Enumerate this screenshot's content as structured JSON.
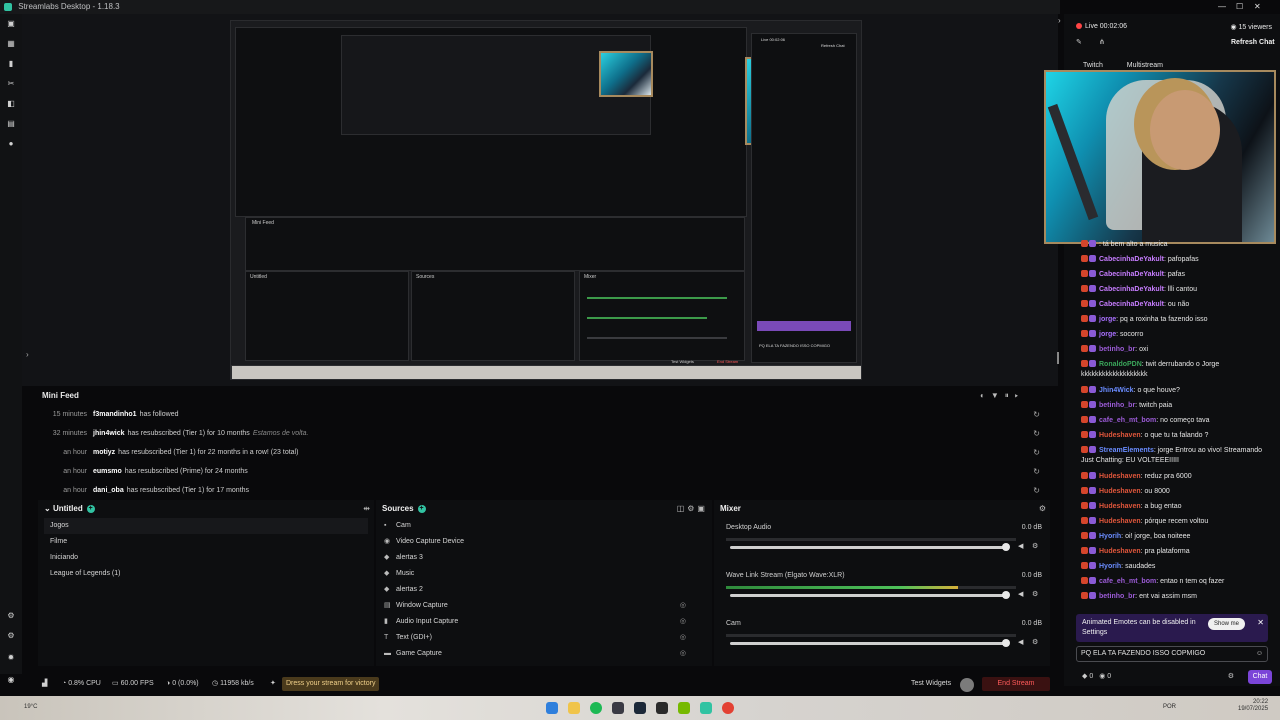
{
  "window": {
    "title": "Streamlabs Desktop - 1.18.3"
  },
  "nested_preview": {
    "live_label": "Live 00:02:06",
    "refresh_label": "Refresh Chat",
    "minifeed_label": "Mini Feed",
    "scenes_label": "Untitled",
    "sources_label": "Sources",
    "mixer_label": "Mixer",
    "end_label": "End Stream",
    "test_label": "Test Widgets",
    "chat_msg": "PQ ELA TA FAZENDO ISSO COPMIGO"
  },
  "minifeed": {
    "title": "Mini Feed",
    "items": [
      {
        "time": "15 minutes",
        "user": "f3mandinho1",
        "text": "has followed",
        "note": ""
      },
      {
        "time": "32 minutes",
        "user": "jhin4wick",
        "text": "has resubscribed (Tier 1) for 10 months",
        "note": "Estamos de volta."
      },
      {
        "time": "an hour",
        "user": "motiyz",
        "text": "has resubscribed (Tier 1) for 22 months in a row! (23 total)",
        "note": ""
      },
      {
        "time": "an hour",
        "user": "eumsmo",
        "text": "has resubscribed (Prime) for 24 months",
        "note": ""
      },
      {
        "time": "an hour",
        "user": "dani_oba",
        "text": "has resubscribed (Tier 1) for 17 months",
        "note": ""
      }
    ]
  },
  "scenes": {
    "title": "Untitled",
    "items": [
      "Jogos",
      "Filme",
      "Iniciando",
      "League of Legends (1)"
    ]
  },
  "sources": {
    "title": "Sources",
    "items": [
      "Cam",
      "Video Capture Device",
      "alertas 3",
      "Music",
      "alertas 2",
      "Window Capture",
      "Audio Input Capture",
      "Text (GDI+)",
      "Game Capture"
    ]
  },
  "mixer": {
    "title": "Mixer",
    "channels": [
      {
        "name": "Desktop Audio",
        "db": "0.0 dB",
        "level": 0.0
      },
      {
        "name": "Wave Link Stream (Elgato Wave:XLR)",
        "db": "0.0 dB",
        "level": 0.8
      },
      {
        "name": "Cam",
        "db": "0.0 dB",
        "level": 0.0
      }
    ]
  },
  "statusbar": {
    "cpu": "0.8% CPU",
    "fps": "60.00 FPS",
    "dropped": "0 (0.0%)",
    "bitrate": "11958 kb/s",
    "dress_label": "Dress your stream for victory",
    "test_widgets": "Test Widgets",
    "end_stream": "End Stream"
  },
  "chat": {
    "live": "Live 00:02:06",
    "viewers": "15 viewers",
    "refresh": "Refresh Chat",
    "tabs": [
      "Twitch",
      "Multistream"
    ],
    "messages": [
      {
        "user": "",
        "text": "tá bem alto a musica",
        "color": "#e0563b"
      },
      {
        "user": "CabecinhaDeYakult",
        "text": "pafopafas",
        "color": "#c77dff"
      },
      {
        "user": "CabecinhaDeYakult",
        "text": "pafas",
        "color": "#c77dff"
      },
      {
        "user": "CabecinhaDeYakult",
        "text": "llli cantou",
        "color": "#c77dff"
      },
      {
        "user": "CabecinhaDeYakult",
        "text": "ou não",
        "color": "#c77dff"
      },
      {
        "user": "jorge",
        "text": "pq a roxinha ta fazendo isso",
        "color": "#a970ff"
      },
      {
        "user": "jorge",
        "text": "socorro",
        "color": "#a970ff"
      },
      {
        "user": "betinho_br",
        "text": "oxi",
        "color": "#9b5bd6"
      },
      {
        "user": "RonaldoPDN",
        "text": "twit derrubando o Jorge kkkkkkkkkkkkkkkkkkk",
        "color": "#3aa55a"
      },
      {
        "user": "Jhin4Wick",
        "text": "o que houve?",
        "color": "#6a8cff"
      },
      {
        "user": "betinho_br",
        "text": "twitch paia",
        "color": "#9b5bd6"
      },
      {
        "user": "cafe_eh_mt_bom",
        "text": "no começo tava",
        "color": "#9b5bd6"
      },
      {
        "user": "Hudeshaven",
        "text": "o que tu ta falando ?",
        "color": "#e0563b"
      },
      {
        "user": "StreamElements",
        "text": "jorge Entrou ao vivo! Streamando Just Chatting: EU VOLTEEEIIIII",
        "color": "#6a8cff"
      },
      {
        "user": "Hudeshaven",
        "text": "reduz pra 6000",
        "color": "#e0563b"
      },
      {
        "user": "Hudeshaven",
        "text": "ou 8000",
        "color": "#e0563b"
      },
      {
        "user": "Hudeshaven",
        "text": "a bug entao",
        "color": "#e0563b"
      },
      {
        "user": "Hudeshaven",
        "text": "pórque recem voltou",
        "color": "#e0563b"
      },
      {
        "user": "Hyorih",
        "text": "oi! jorge, boa noiteee",
        "color": "#6a8cff"
      },
      {
        "user": "Hudeshaven",
        "text": "pra plataforma",
        "color": "#e0563b"
      },
      {
        "user": "Hyorih",
        "text": "saudades",
        "color": "#6a8cff"
      },
      {
        "user": "cafe_eh_mt_bom",
        "text": "entao n tem oq fazer",
        "color": "#9b5bd6"
      },
      {
        "user": "betinho_br",
        "text": "ent vai assim msm",
        "color": "#9b5bd6"
      }
    ],
    "emote_banner": "Animated Emotes can be disabled in Settings",
    "show_me": "Show me",
    "input_value": "PQ ELA TA FAZENDO ISSO COPMIGO",
    "points": "0",
    "points2": "0",
    "chat_button": "Chat"
  },
  "taskbar": {
    "weather": "19°C",
    "lang": "POR",
    "time": "20:22",
    "date": "19/07/2025"
  },
  "colors": {
    "accent": "#31c3a2",
    "end_stream": "#ff5a5a",
    "chat_button": "#7b45d8"
  }
}
